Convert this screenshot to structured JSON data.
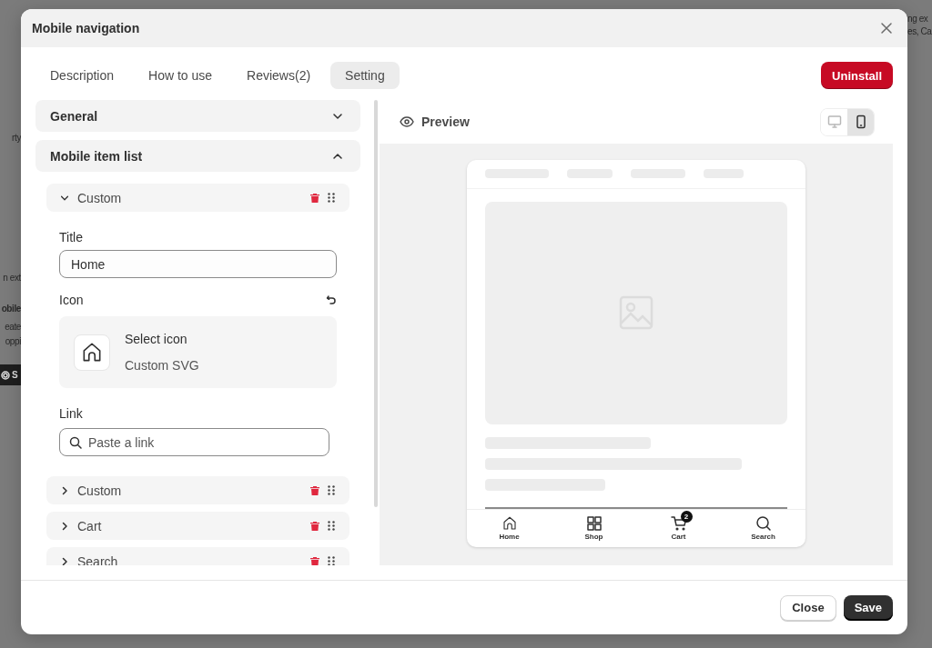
{
  "background": {
    "left_fragments": [
      {
        "text": "rty",
        "kind": "plain"
      },
      {
        "text": "n ext",
        "kind": "plain"
      },
      {
        "text": "obile",
        "kind": "bold"
      },
      {
        "text": "eate",
        "kind": "plain"
      },
      {
        "text": "oppi",
        "kind": "plain"
      },
      {
        "text": "S",
        "kind": "button"
      }
    ],
    "right_fragments": [
      {
        "text": "ng ex"
      },
      {
        "text": "es, Ca"
      }
    ]
  },
  "window": {
    "title": "Mobile navigation"
  },
  "tabs": [
    {
      "label": "Description",
      "selected": false
    },
    {
      "label": "How to use",
      "selected": false
    },
    {
      "label": "Reviews(2)",
      "selected": false
    },
    {
      "label": "Setting",
      "selected": true
    }
  ],
  "uninstall_button": "Uninstall",
  "sections": [
    {
      "title": "General",
      "expanded": false
    },
    {
      "title": "Mobile item list",
      "expanded": true
    }
  ],
  "items": [
    {
      "label": "Custom",
      "expanded": true,
      "title_label": "Title",
      "title_value": "Home",
      "icon_label": "Icon",
      "icon_picker": {
        "title": "Select icon",
        "subtitle": "Custom SVG"
      },
      "link_label": "Link",
      "link_placeholder": "Paste a link"
    },
    {
      "label": "Custom",
      "expanded": false
    },
    {
      "label": "Cart",
      "expanded": false
    },
    {
      "label": "Search",
      "expanded": false
    }
  ],
  "preview": {
    "title": "Preview",
    "devices": [
      {
        "kind": "desktop",
        "selected": false
      },
      {
        "kind": "mobile",
        "selected": true
      }
    ],
    "nav": [
      {
        "label": "Home",
        "kind": "home"
      },
      {
        "label": "Shop",
        "kind": "grid"
      },
      {
        "label": "Cart",
        "kind": "cart",
        "badge": "2"
      },
      {
        "label": "Search",
        "kind": "search"
      }
    ]
  },
  "footer": {
    "buttons": [
      {
        "label": "Close",
        "kind": "secondary"
      },
      {
        "label": "Save",
        "kind": "primary"
      }
    ]
  }
}
